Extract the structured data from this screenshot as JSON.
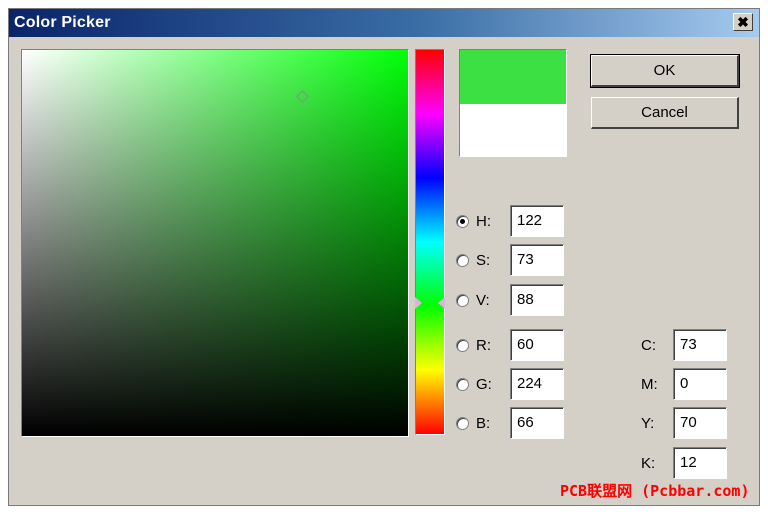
{
  "window": {
    "title": "Color Picker",
    "close_label": "✖"
  },
  "colors": {
    "hue_color": "#00ff08",
    "new_color": "#3ce042",
    "old_color": "#ffffff"
  },
  "buttons": {
    "ok": "OK",
    "cancel": "Cancel"
  },
  "hsv_rgb_fields": [
    {
      "label": "H:",
      "value": "122",
      "checked": true
    },
    {
      "label": "S:",
      "value": "73",
      "checked": false
    },
    {
      "label": "V:",
      "value": "88",
      "checked": false
    },
    {
      "label": "R:",
      "value": "60",
      "checked": false
    },
    {
      "label": "G:",
      "value": "224",
      "checked": false
    },
    {
      "label": "B:",
      "value": "66",
      "checked": false
    }
  ],
  "cmyk_fields": [
    {
      "label": "C:",
      "value": "73"
    },
    {
      "label": "M:",
      "value": "0"
    },
    {
      "label": "Y:",
      "value": "70"
    },
    {
      "label": "K:",
      "value": "12"
    }
  ],
  "watermark": "PCB联盟网 (Pcbbar.com)"
}
